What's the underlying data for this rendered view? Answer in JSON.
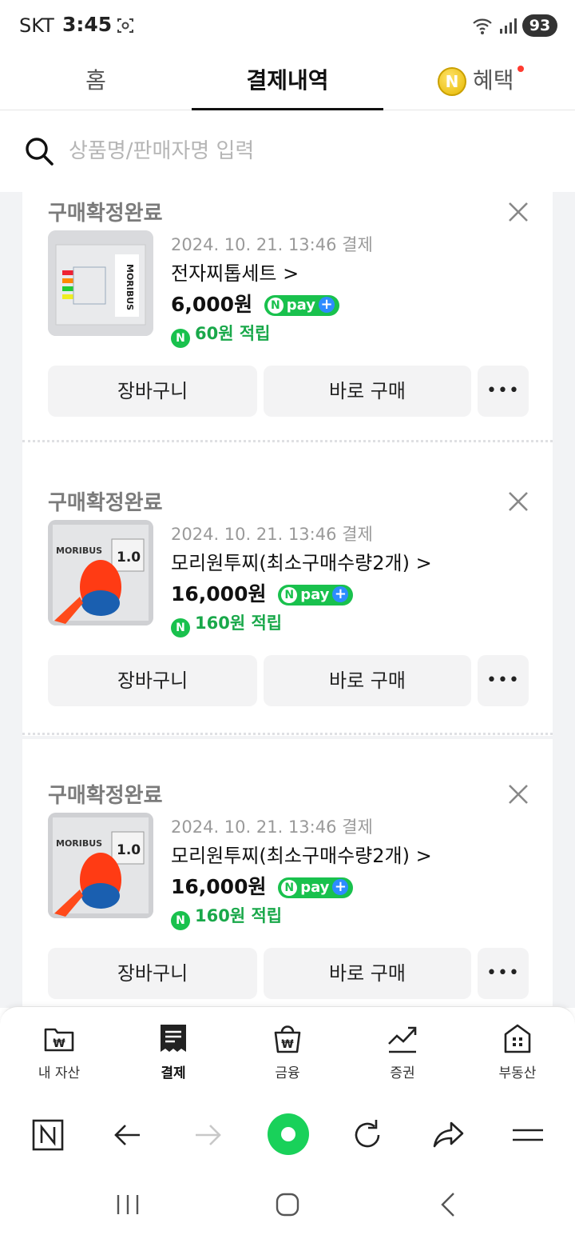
{
  "status_bar": {
    "carrier": "SKT",
    "time": "3:45",
    "battery": "93"
  },
  "tabs": {
    "home": "홈",
    "payment": "결제내역",
    "benefit": "혜택"
  },
  "search": {
    "placeholder": "상품명/판매자명 입력"
  },
  "orders": [
    {
      "status": "구매확정완료",
      "date": "2024. 10. 21. 13:46 결제",
      "name": "전자찌톱세트 >",
      "price": "6,000원",
      "reward": "60원 적립",
      "cart_label": "장바구니",
      "buy_label": "바로 구매",
      "more_label": "•••"
    },
    {
      "status": "구매확정완료",
      "date": "2024. 10. 21. 13:46 결제",
      "name": "모리원투찌(최소구매수량2개) >",
      "price": "16,000원",
      "reward": "160원 적립",
      "cart_label": "장바구니",
      "buy_label": "바로 구매",
      "more_label": "•••"
    },
    {
      "status": "구매확정완료",
      "date": "2024. 10. 21. 13:46 결제",
      "name": "모리원투찌(최소구매수량2개) >",
      "price": "16,000원",
      "reward": "160원 적립",
      "cart_label": "장바구니",
      "buy_label": "바로 구매",
      "more_label": "•••"
    }
  ],
  "npay": {
    "label": "pay",
    "n": "N",
    "plus": "+"
  },
  "thumb_text": {
    "brand": "MORIBUS",
    "float_size": "1.0"
  },
  "bottom_nav": [
    "내 자산",
    "결제",
    "금융",
    "증권",
    "부동산"
  ],
  "colors": {
    "naver_green": "#19c14d",
    "reward_green": "#19a84a",
    "status_gray": "#7b7b7b"
  }
}
